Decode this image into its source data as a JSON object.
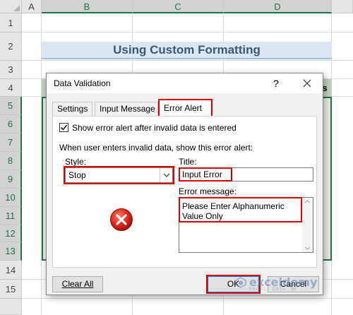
{
  "sheet": {
    "columns": [
      "A",
      "B",
      "C",
      "D"
    ],
    "rows": [
      "1",
      "2",
      "3",
      "4",
      "5",
      "6",
      "7",
      "8",
      "9",
      "10",
      "11",
      "12",
      "13",
      "14",
      "15"
    ],
    "title": "Using Custom Formatting",
    "header_tail_text": "s",
    "colors": {
      "selection": "#217346",
      "title_band": "#dbe6f3",
      "header_band": "#c3d3bc"
    }
  },
  "dialog": {
    "title": "Data Validation",
    "help_label": "?",
    "tabs": [
      {
        "label": "Settings",
        "active": false
      },
      {
        "label": "Input Message",
        "active": false
      },
      {
        "label": "Error Alert",
        "active": true
      }
    ],
    "show_error_checkbox": {
      "checked": true,
      "label": "Show error alert after invalid data is entered"
    },
    "subtitle": "When user enters invalid data, show this error alert:",
    "style": {
      "label": "Style:",
      "value": "Stop"
    },
    "title_field": {
      "label": "Title:",
      "value": "Input Error"
    },
    "error_message": {
      "label": "Error message:",
      "value": "Please Enter Alphanumeric Value Only"
    },
    "icon": "stop-error-icon",
    "buttons": {
      "clear_all": "Clear All",
      "ok": "OK",
      "cancel": "Cancel"
    },
    "highlight_color": "#e00000"
  },
  "watermark": {
    "name": "exceldemy",
    "tagline": "EXCEL · DATA · BI"
  }
}
